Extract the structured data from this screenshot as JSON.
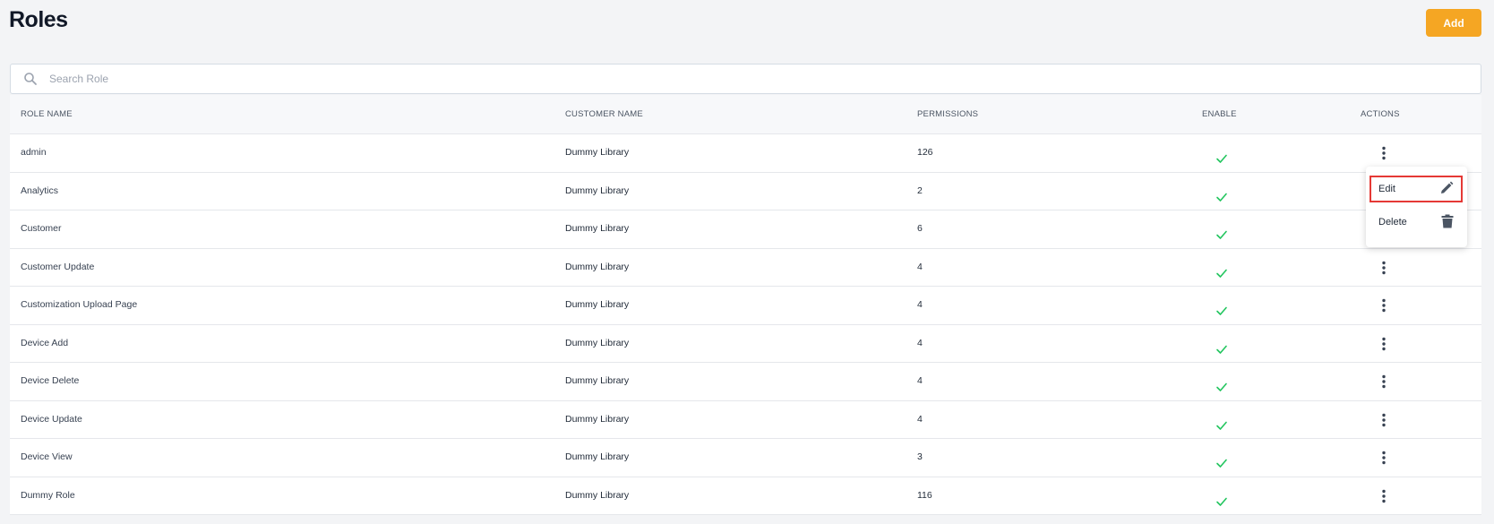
{
  "header": {
    "title": "Roles",
    "add_label": "Add"
  },
  "search": {
    "placeholder": "Search Role",
    "value": ""
  },
  "table": {
    "columns": [
      "ROLE NAME",
      "CUSTOMER NAME",
      "PERMISSIONS",
      "ENABLE",
      "ACTIONS"
    ],
    "rows": [
      {
        "role": "admin",
        "customer": "Dummy Library",
        "permissions": "126",
        "enabled": true
      },
      {
        "role": "Analytics",
        "customer": "Dummy Library",
        "permissions": "2",
        "enabled": true
      },
      {
        "role": "Customer",
        "customer": "Dummy Library",
        "permissions": "6",
        "enabled": true
      },
      {
        "role": "Customer Update",
        "customer": "Dummy Library",
        "permissions": "4",
        "enabled": true
      },
      {
        "role": "Customization Upload Page",
        "customer": "Dummy Library",
        "permissions": "4",
        "enabled": true
      },
      {
        "role": "Device Add",
        "customer": "Dummy Library",
        "permissions": "4",
        "enabled": true
      },
      {
        "role": "Device Delete",
        "customer": "Dummy Library",
        "permissions": "4",
        "enabled": true
      },
      {
        "role": "Device Update",
        "customer": "Dummy Library",
        "permissions": "4",
        "enabled": true
      },
      {
        "role": "Device View",
        "customer": "Dummy Library",
        "permissions": "3",
        "enabled": true
      },
      {
        "role": "Dummy Role",
        "customer": "Dummy Library",
        "permissions": "116",
        "enabled": true
      }
    ]
  },
  "actions_menu": {
    "edit_label": "Edit",
    "delete_label": "Delete",
    "edit_icon": "pencil-icon",
    "delete_icon": "trash-icon"
  },
  "colors": {
    "accent": "#f5a623",
    "check": "#22c55e",
    "highlight": "#e53935"
  }
}
